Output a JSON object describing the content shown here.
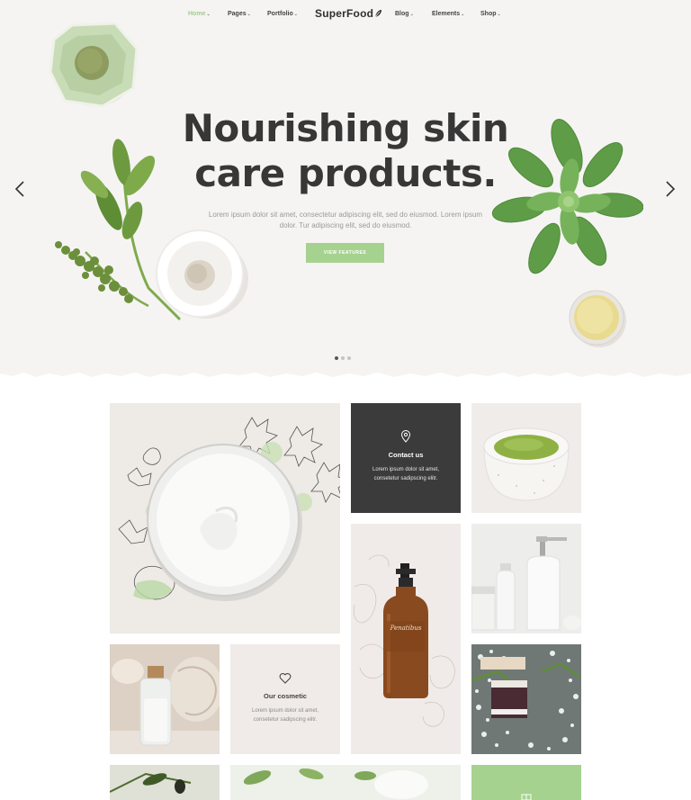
{
  "nav": {
    "left": [
      {
        "label": "Home",
        "active": true
      },
      {
        "label": "Pages"
      },
      {
        "label": "Portfolio"
      }
    ],
    "logo": "SuperFood",
    "right": [
      {
        "label": "Blog"
      },
      {
        "label": "Elements"
      },
      {
        "label": "Shop"
      }
    ]
  },
  "hero": {
    "title_line1": "Nourishing skin",
    "title_line2": "care products.",
    "subtitle": "Lorem ipsum dolor sit amet, consectetur adipiscing elit, sed do eiusmod. Lorem ipsum dolor. Tur adipiscing elit, sed do eiusmod.",
    "button": "VIEW FEATURES",
    "slides_total": 3,
    "slide_current": 1
  },
  "tiles": {
    "contact": {
      "title": "Contact us",
      "text_line1": "Lorem ipsum dolor sit amet,",
      "text_line2": "consetetur sadipscing elitr."
    },
    "cosmetic": {
      "title": "Our cosmetic",
      "text_line1": "Lorem ipsum dolor sit amet,",
      "text_line2": "consetetur sadipscing elitr."
    },
    "bottle_label": "Penatibus"
  },
  "colors": {
    "accent": "#a6d28f",
    "hero_bg": "#f5f4f3",
    "dark_tile": "#3b3b3b",
    "light_tile": "#f0ebe8",
    "heading": "#373737"
  }
}
